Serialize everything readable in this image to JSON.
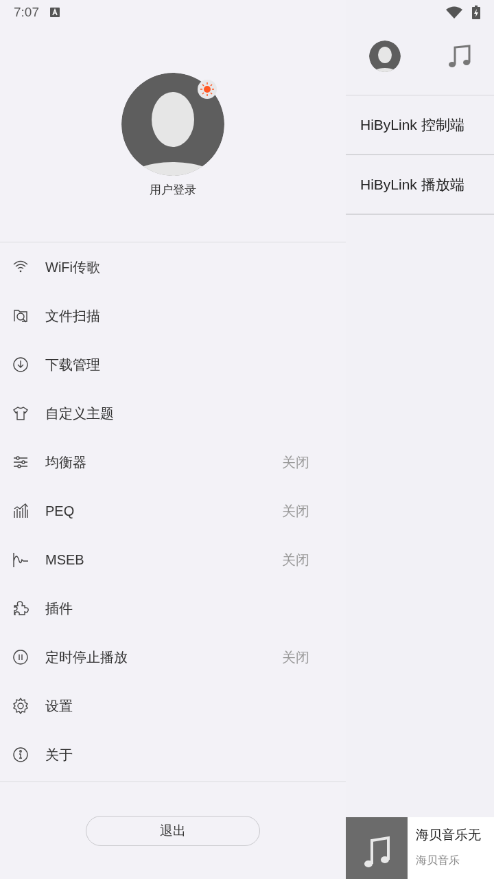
{
  "status_bar": {
    "time": "7:07"
  },
  "profile": {
    "label": "用户登录"
  },
  "menu": [
    {
      "kind": "wifi",
      "label": "WiFi传歌"
    },
    {
      "kind": "scan",
      "label": "文件扫描"
    },
    {
      "kind": "download",
      "label": "下载管理"
    },
    {
      "kind": "shirt",
      "label": "自定义主题"
    },
    {
      "kind": "sliders",
      "label": "均衡器",
      "value": "关闭"
    },
    {
      "kind": "peq",
      "label": "PEQ",
      "value": "关闭"
    },
    {
      "kind": "wave",
      "label": "MSEB",
      "value": "关闭"
    },
    {
      "kind": "puzzle",
      "label": "插件"
    },
    {
      "kind": "timer",
      "label": "定时停止播放",
      "value": "关闭"
    },
    {
      "kind": "gear",
      "label": "设置"
    },
    {
      "kind": "info",
      "label": "关于"
    }
  ],
  "logout_button": "退出",
  "side_panel": {
    "items": [
      "HiByLink 控制端",
      "HiByLink 播放端"
    ]
  },
  "mini_player": {
    "title": "海贝音乐无",
    "artist": "海贝音乐"
  }
}
